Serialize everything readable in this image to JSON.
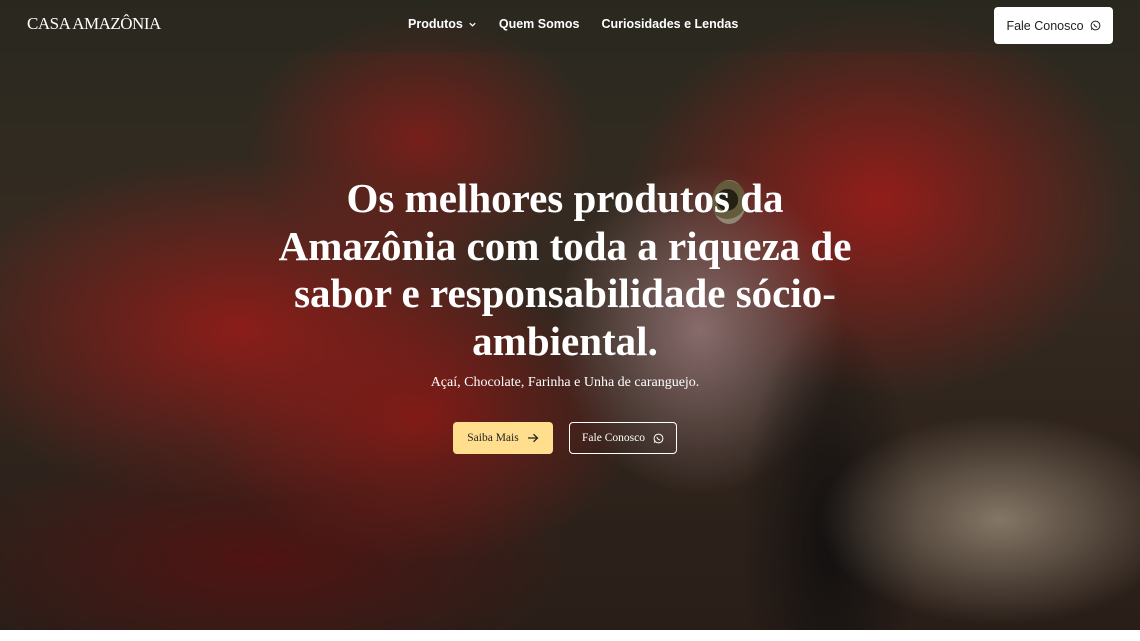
{
  "navbar": {
    "logo": "CASA AMAZÔNIA",
    "menu": [
      {
        "label": "Produtos",
        "has_dropdown": true
      },
      {
        "label": "Quem Somos"
      },
      {
        "label": "Curiosidades e Lendas"
      }
    ],
    "cta_label": "Fale Conosco",
    "cta_icon": "whatsapp-icon"
  },
  "hero": {
    "headline": "Os melhores produtos da Amazônia com toda a riqueza de sabor e responsabilidade sócio-ambiental.",
    "subtitle": "Açaí, Chocolate, Farinha e Unha de caranguejo.",
    "primary_button": {
      "label": "Saiba Mais",
      "icon": "arrow-right-icon"
    },
    "secondary_button": {
      "label": "Fale Conosco",
      "icon": "whatsapp-icon"
    },
    "background": "scarlet macaw close-up"
  },
  "colors": {
    "accent_button": "#ffdf8e",
    "nav_button_bg": "#ffffff",
    "text": "#ffffff"
  }
}
